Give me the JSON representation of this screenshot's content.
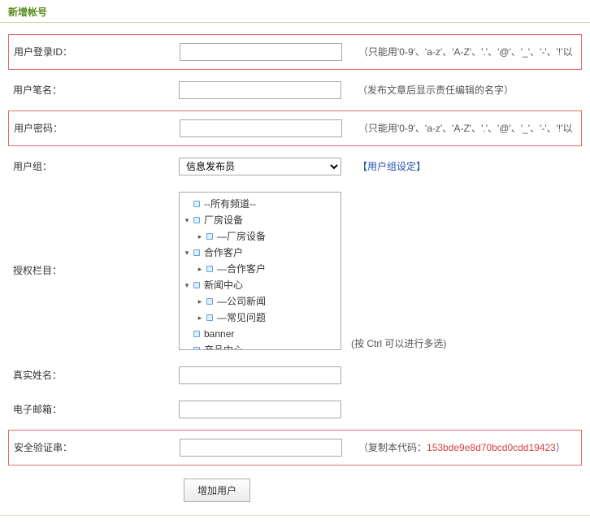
{
  "header": {
    "title": "新增帐号"
  },
  "rows": {
    "login_id": {
      "label": "用户登录ID：",
      "hint": "（只能用'0-9'、'a-z'、'A-Z'、'.'、'@'、'_'、'-'、'!'以"
    },
    "penname": {
      "label": "用户笔名：",
      "hint": "（发布文章后显示责任编辑的名字）"
    },
    "password": {
      "label": "用户密码：",
      "hint": "（只能用'0-9'、'a-z'、'A-Z'、'.'、'@'、'_'、'-'、'!'以"
    },
    "group": {
      "label": "用户组：",
      "selected": "信息发布员",
      "settings_link": "【用户组设定】"
    },
    "cols": {
      "label": "授权栏目：",
      "multi_hint": "(按 Ctrl 可以进行多选)"
    },
    "realname": {
      "label": "真实姓名："
    },
    "email": {
      "label": "电子邮箱："
    },
    "seccode": {
      "label": "安全验证串：",
      "hint_prefix": "（复制本代码：",
      "code": "153bde9e8d70bcd0cdd19423",
      "hint_suffix": "）"
    }
  },
  "tree": [
    {
      "level": 0,
      "toggle": "",
      "label": "--所有频道--"
    },
    {
      "level": 0,
      "toggle": "▾",
      "label": "厂房设备"
    },
    {
      "level": 1,
      "toggle": "▸",
      "label": "—厂房设备"
    },
    {
      "level": 0,
      "toggle": "▾",
      "label": "合作客户"
    },
    {
      "level": 1,
      "toggle": "▸",
      "label": "—合作客户"
    },
    {
      "level": 0,
      "toggle": "▾",
      "label": "新闻中心"
    },
    {
      "level": 1,
      "toggle": "▸",
      "label": "—公司新闻"
    },
    {
      "level": 1,
      "toggle": "▸",
      "label": "—常见问题"
    },
    {
      "level": 0,
      "toggle": "",
      "label": "banner"
    },
    {
      "level": 0,
      "toggle": "",
      "label": "产品中心"
    }
  ],
  "submit": {
    "label": "增加用户"
  }
}
